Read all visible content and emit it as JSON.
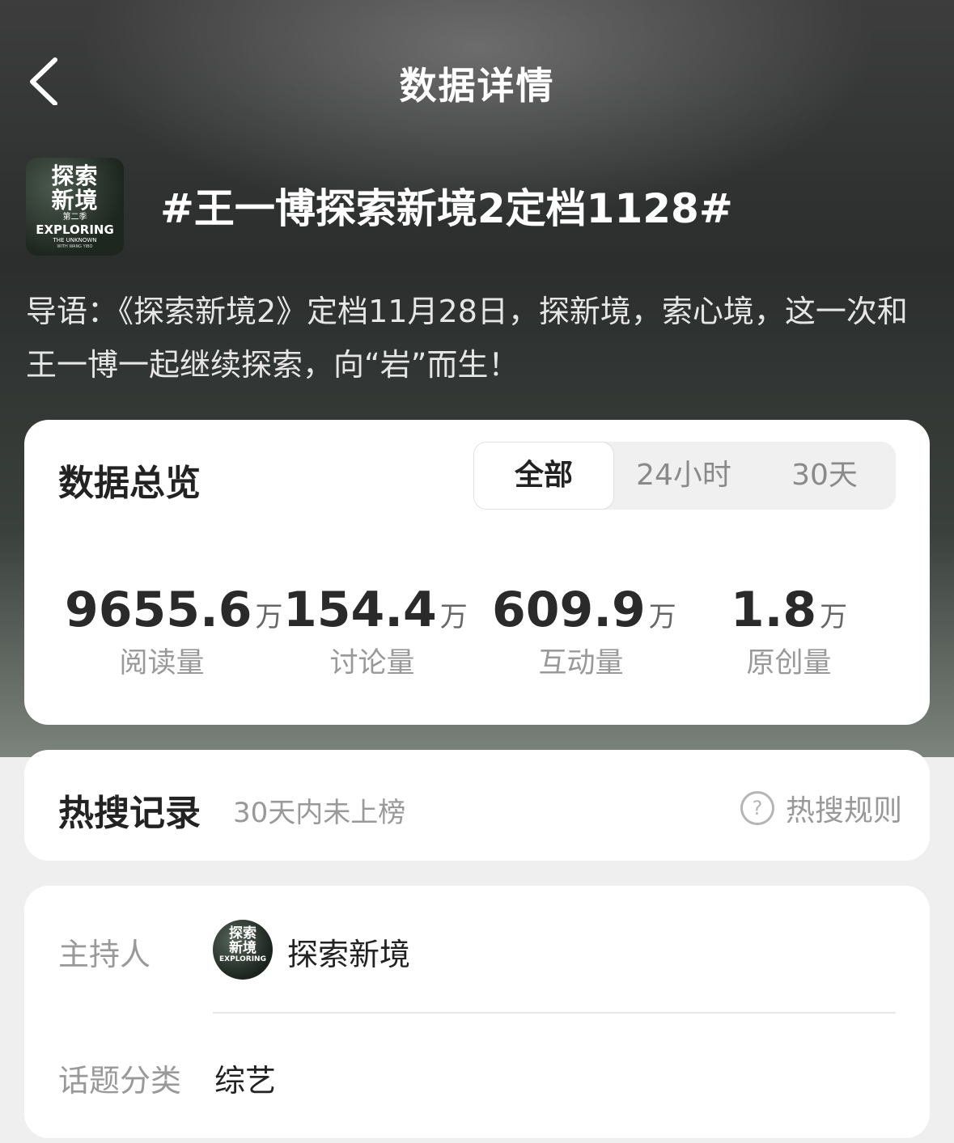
{
  "header": {
    "title": "数据详情",
    "back_icon": "chevron-left-icon"
  },
  "topic": {
    "title": "#王一博探索新境2定档1128#",
    "logo": {
      "cn": "探索\n新境",
      "season": "第二季",
      "en": "EXPLORING",
      "en_sub": "THE UNKNOWN",
      "en_tag": "WITH WANG YIBO"
    },
    "intro": "导语：《探索新境2》定档11月28日，探新境，索心境，这一次和王一博一起继续探索，向“岩”而生！"
  },
  "overview": {
    "heading": "数据总览",
    "tabs": [
      {
        "label": "全部",
        "active": true
      },
      {
        "label": "24小时",
        "active": false
      },
      {
        "label": "30天",
        "active": false
      }
    ],
    "stats": [
      {
        "value": "9655.6",
        "unit": "万",
        "label": "阅读量"
      },
      {
        "value": "154.4",
        "unit": "万",
        "label": "讨论量"
      },
      {
        "value": "609.9",
        "unit": "万",
        "label": "互动量"
      },
      {
        "value": "1.8",
        "unit": "万",
        "label": "原创量"
      }
    ]
  },
  "hot_search": {
    "heading": "热搜记录",
    "status": "30天内未上榜",
    "rules_label": "热搜规则",
    "rules_icon": "question-circle-icon"
  },
  "info": {
    "host_label": "主持人",
    "host_name": "探索新境",
    "host_avatar": {
      "cn": "探索\n新境",
      "en": "EXPLORING"
    },
    "category_label": "话题分类",
    "category_value": "综艺"
  },
  "colors": {
    "card_bg": "#ffffff",
    "page_bg": "#efefef",
    "muted_text": "#999999",
    "primary_text": "#222222"
  }
}
